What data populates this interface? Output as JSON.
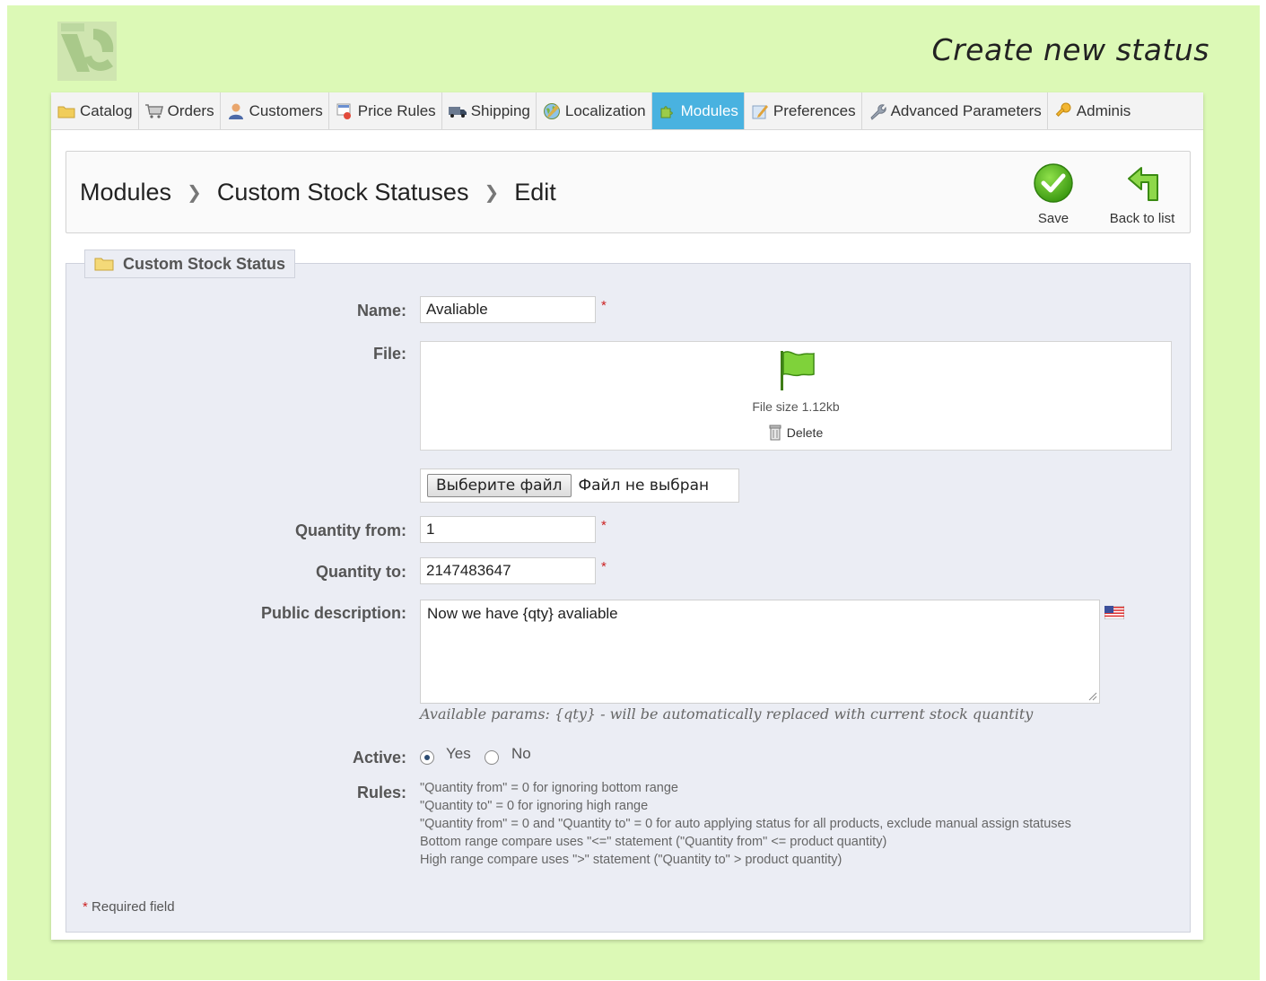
{
  "promo_title": "Create new status",
  "nav": {
    "tabs": [
      {
        "label": "Catalog",
        "icon": "folder-icon"
      },
      {
        "label": "Orders",
        "icon": "cart-icon"
      },
      {
        "label": "Customers",
        "icon": "user-icon"
      },
      {
        "label": "Price Rules",
        "icon": "price-tag-icon"
      },
      {
        "label": "Shipping",
        "icon": "truck-icon"
      },
      {
        "label": "Localization",
        "icon": "globe-icon"
      },
      {
        "label": "Modules",
        "icon": "puzzle-icon",
        "active": true
      },
      {
        "label": "Preferences",
        "icon": "preferences-icon"
      },
      {
        "label": "Advanced Parameters",
        "icon": "wrench-icon"
      },
      {
        "label": "Adminis",
        "icon": "key-icon"
      }
    ]
  },
  "breadcrumb": {
    "items": [
      "Modules",
      "Custom Stock Statuses",
      "Edit"
    ]
  },
  "toolbar": {
    "save_label": "Save",
    "back_label": "Back to list"
  },
  "form": {
    "legend": "Custom Stock Status",
    "name_label": "Name:",
    "name_value": "Avaliable",
    "file_label": "File:",
    "file_size": "File size 1.12kb",
    "delete_label": "Delete",
    "choose_file_label": "Выберите файл",
    "file_status": "Файл не выбран",
    "qty_from_label": "Quantity from:",
    "qty_from_value": "1",
    "qty_to_label": "Quantity to:",
    "qty_to_value": "2147483647",
    "desc_label": "Public description:",
    "desc_value": "Now we have {qty} avaliable",
    "desc_hint": "Available params: {qty} - will be automatically replaced with current stock quantity",
    "active_label": "Active:",
    "yes_label": "Yes",
    "no_label": "No",
    "active_selected": "Yes",
    "rules_label": "Rules:",
    "rules": [
      "\"Quantity from\" = 0 for ignoring bottom range",
      "\"Quantity to\" = 0 for ignoring high range",
      "\"Quantity from\" = 0 and \"Quantity to\" = 0 for auto applying status for all products, exclude manual assign statuses",
      "Bottom range compare uses \"<=\" statement (\"Quantity from\" <= product quantity)",
      "High range compare uses \">\" statement (\"Quantity to\" > product quantity)"
    ],
    "required_mark": "*",
    "required_note": "Required field"
  },
  "colors": {
    "page_bg": "#dcf9b6",
    "active_tab": "#49b2e0",
    "fieldset_bg": "#ebedf4",
    "required": "#cc2222"
  }
}
